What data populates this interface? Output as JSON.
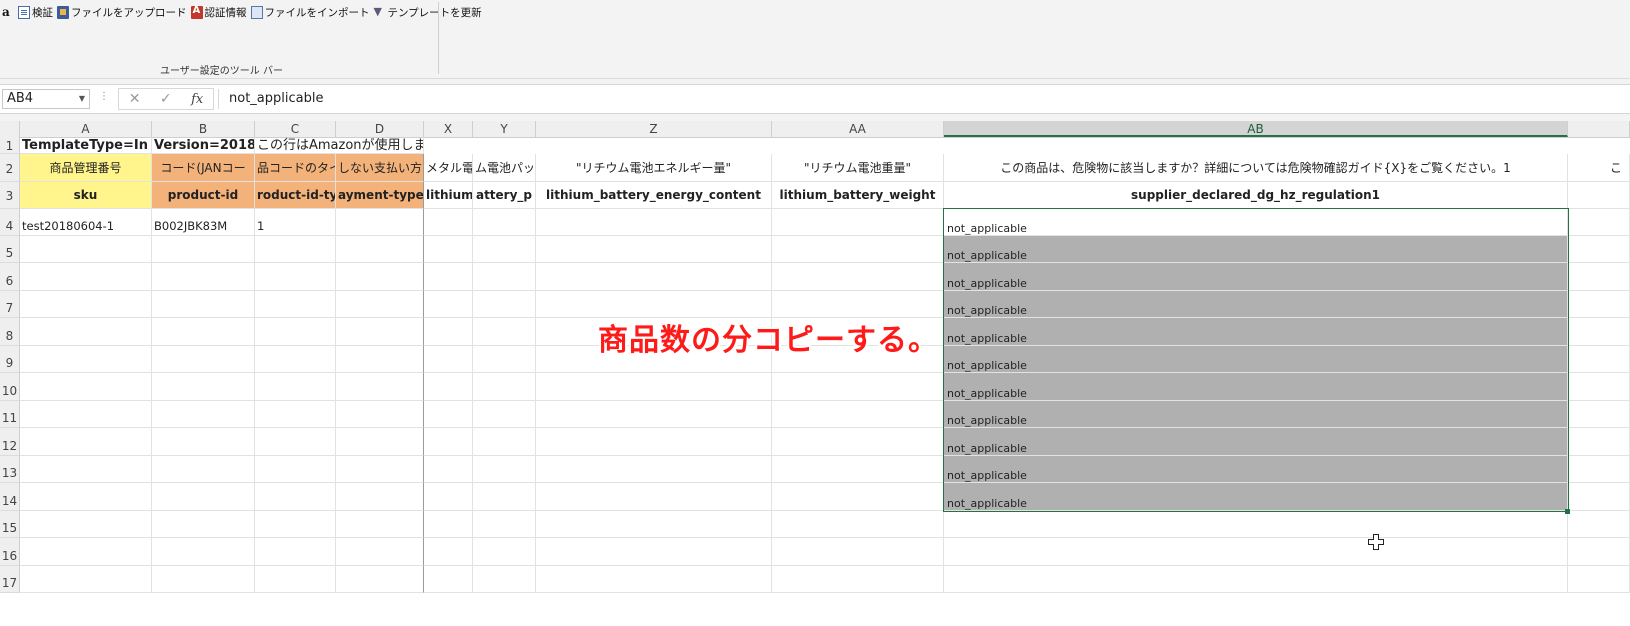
{
  "toolbar": {
    "items": [
      {
        "label": "",
        "icon": "amazon-icon"
      },
      {
        "label": "検証",
        "icon": "validate-icon"
      },
      {
        "label": "ファイルをアップロード",
        "icon": "upload-icon"
      },
      {
        "label": "認証情報",
        "icon": "auth-icon"
      },
      {
        "label": "ファイルをインポート",
        "icon": "import-icon"
      },
      {
        "label": "テンプレートを更新",
        "icon": "template-update-icon"
      }
    ],
    "group_label": "ユーザー設定のツール バー"
  },
  "formula_bar": {
    "name_box": "AB4",
    "cancel_symbol": "✕",
    "enter_symbol": "✓",
    "fx_symbol": "fx",
    "value": "not_applicable"
  },
  "columns": [
    "",
    "A",
    "B",
    "C",
    "D",
    "X",
    "Y",
    "Z",
    "AA",
    "AB",
    ""
  ],
  "rows": [
    "1",
    "2",
    "3",
    "4",
    "5",
    "6",
    "7",
    "8",
    "9",
    "10",
    "11",
    "12",
    "13",
    "14",
    "15",
    "16",
    "17"
  ],
  "cells": {
    "r1_a": "TemplateType=In",
    "r1_b": "Version=2018",
    "r1_c": "この行はAmazonが使用します",
    "r2_a": "商品管理番号",
    "r2_b": "コード(JANコー",
    "r2_c": "品コードのタイ",
    "r2_d": "しない支払い方",
    "r2_x": "メタル電",
    "r2_y": "ム電池パッ",
    "r2_z": "\"リチウム電池エネルギー量\"",
    "r2_aa": "\"リチウム電池重量\"",
    "r2_ab": "この商品は、危険物に該当しますか？詳細については危険物確認ガイド{X}をご覧ください。1",
    "r2_ac": "こ",
    "r3_a": "sku",
    "r3_b": "product-id",
    "r3_c": "roduct-id-typ",
    "r3_d": "ayment-type",
    "r3_x": "lithium",
    "r3_y": "attery_p",
    "r3_z": "lithium_battery_energy_content",
    "r3_aa": "lithium_battery_weight",
    "r3_ab": "supplier_declared_dg_hz_regulation1",
    "r4_a": "test20180604-1",
    "r4_b": "B002JBK83M",
    "r4_c": "1",
    "ab_values": [
      "not_applicable",
      "not_applicable",
      "not_applicable",
      "not_applicable",
      "not_applicable",
      "not_applicable",
      "not_applicable",
      "not_applicable",
      "not_applicable",
      "not_applicable",
      "not_applicable"
    ]
  },
  "annotation": "商品数の分コピーする。",
  "colors": {
    "accent": "#217346",
    "annotation": "#ff1a1a",
    "yellow": "#fff58c",
    "orange": "#f3b27a",
    "selection_fill": "#b0b0b0"
  }
}
